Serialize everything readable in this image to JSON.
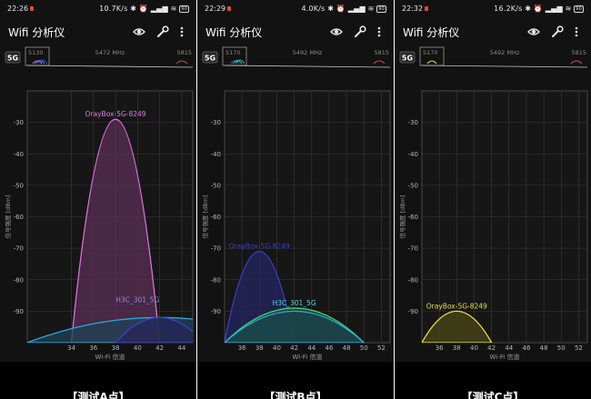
{
  "panels": [
    {
      "status": {
        "time": "22:26",
        "net": "10.7K/s",
        "battery": "90"
      },
      "app": {
        "title": "Wifi 分析仪"
      },
      "band": "5G",
      "overview": {
        "left_freq": "5130",
        "center_freq": "5472 MHz",
        "right_freq": "5815"
      },
      "y_axis_label": "信号强度 [dBm]",
      "x_axis_label": "Wi-Fi 信道",
      "y_ticks": [
        -30,
        -40,
        -50,
        -60,
        -70,
        -80,
        -90
      ],
      "x_ticks": [
        34,
        36,
        38,
        40,
        42,
        44
      ],
      "caption": "【测试A点】",
      "chart_data": {
        "type": "area",
        "x_axis": {
          "label": "Wi-Fi 信道",
          "range": [
            30,
            45
          ],
          "ticks": [
            34,
            36,
            38,
            40,
            42,
            44
          ]
        },
        "y_axis": {
          "label": "信号强度 [dBm]",
          "range": [
            -100,
            -20
          ],
          "ticks": [
            -30,
            -40,
            -50,
            -60,
            -70,
            -80,
            -90
          ]
        },
        "series": [
          {
            "name": "OrayBox-5G-8249",
            "center": 38,
            "width": 8,
            "peak": -29,
            "color": "#e070e0",
            "fill": "#5a2f55",
            "label_color": "#e07be0"
          },
          {
            "name": "H3C_301_5G",
            "center": 42,
            "width": 24,
            "peak": -92,
            "color": "#2aa9e0",
            "fill": "#1e4256",
            "label_color": "#8a8ee8"
          },
          {
            "name": "OrayBox-5G-8249",
            "center": 42,
            "width": 8,
            "peak": -92,
            "color": "#3a3fc8",
            "fill": "#252657",
            "label_color": "#3a3fc8"
          }
        ],
        "labels": [
          {
            "text": "OrayBox-5G-8249",
            "x": 38,
            "y": -29,
            "color": "#e07be0"
          },
          {
            "text": "H3C_301_5G",
            "x": 40,
            "y": -88,
            "color": "#8a8ee8"
          }
        ]
      }
    },
    {
      "status": {
        "time": "22:29",
        "net": "4.0K/s",
        "battery": "90"
      },
      "app": {
        "title": "Wifi 分析仪"
      },
      "band": "5G",
      "overview": {
        "left_freq": "5170",
        "center_freq": "5492 MHz",
        "right_freq": "5815"
      },
      "y_axis_label": "信号强度 [dBm]",
      "x_axis_label": "Wi-Fi 信道",
      "y_ticks": [
        -30,
        -40,
        -50,
        -60,
        -70,
        -80,
        -90
      ],
      "x_ticks": [
        36,
        38,
        40,
        42,
        44,
        46,
        48,
        50,
        52
      ],
      "caption": "【测试B点】",
      "chart_data": {
        "type": "area",
        "x_axis": {
          "label": "Wi-Fi 信道",
          "range": [
            34,
            53
          ],
          "ticks": [
            36,
            38,
            40,
            42,
            44,
            46,
            48,
            50,
            52
          ]
        },
        "y_axis": {
          "label": "信号强度 [dBm]",
          "range": [
            -100,
            -20
          ],
          "ticks": [
            -30,
            -40,
            -50,
            -60,
            -70,
            -80,
            -90
          ]
        },
        "series": [
          {
            "name": "OrayBox-5G-8249",
            "center": 38,
            "width": 8,
            "peak": -71,
            "color": "#3a3fc8",
            "fill": "#242660",
            "label_color": "#3a3fc8"
          },
          {
            "name": "H3C_301_5G",
            "center": 42,
            "width": 16,
            "peak": -89,
            "color": "#3cd870",
            "fill": "#1f5232",
            "label_color": "#4ad8e0"
          },
          {
            "name": "H3C_301_5G",
            "center": 42,
            "width": 16,
            "peak": -90,
            "color": "#2aa9e0",
            "fill": "#1b4350",
            "label_color": "#4ad8e0"
          }
        ],
        "labels": [
          {
            "text": "OrayBox-5G-8249",
            "x": 38,
            "y": -71,
            "color": "#3a3fc8"
          },
          {
            "text": "H3C_301_5G",
            "x": 42,
            "y": -89,
            "color": "#4ad8e0"
          }
        ]
      }
    },
    {
      "status": {
        "time": "22:32",
        "net": "16.2K/s",
        "battery": "90"
      },
      "app": {
        "title": "Wifi 分析仪"
      },
      "band": "5G",
      "overview": {
        "left_freq": "5170",
        "center_freq": "5492 MHz",
        "right_freq": "5815"
      },
      "y_axis_label": "信号强度 [dBm]",
      "x_axis_label": "Wi-Fi 信道",
      "y_ticks": [
        -30,
        -40,
        -50,
        -60,
        -70,
        -80,
        -90
      ],
      "x_ticks": [
        36,
        38,
        40,
        42,
        44,
        46,
        48,
        50,
        52
      ],
      "caption": "【测试C点】",
      "chart_data": {
        "type": "area",
        "x_axis": {
          "label": "Wi-Fi 信道",
          "range": [
            34,
            53
          ],
          "ticks": [
            36,
            38,
            40,
            42,
            44,
            46,
            48,
            50,
            52
          ]
        },
        "y_axis": {
          "label": "信号强度 [dBm]",
          "range": [
            -100,
            -20
          ],
          "ticks": [
            -30,
            -40,
            -50,
            -60,
            -70,
            -80,
            -90
          ]
        },
        "series": [
          {
            "name": "OrayBox-5G-8249",
            "center": 38,
            "width": 8,
            "peak": -90,
            "color": "#e8e040",
            "fill": "#4a4718",
            "label_color": "#e8e040"
          }
        ],
        "labels": [
          {
            "text": "OrayBox-5G-8249",
            "x": 38,
            "y": -90,
            "color": "#e8e040"
          }
        ]
      }
    }
  ]
}
